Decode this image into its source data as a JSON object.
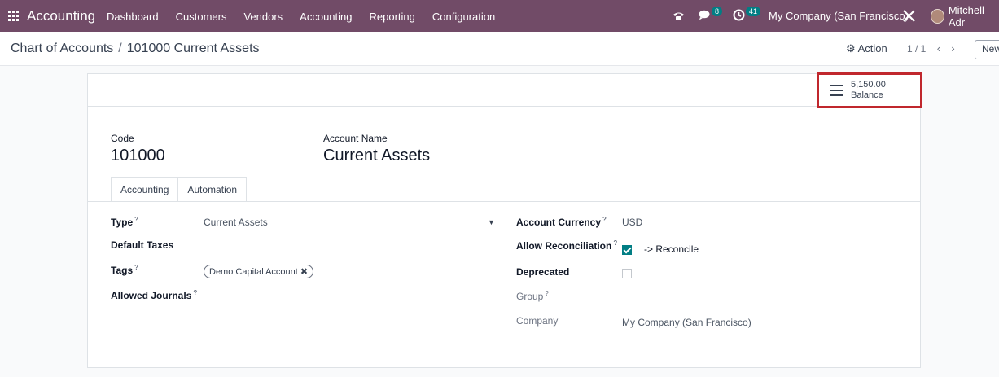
{
  "navbar": {
    "app_name": "Accounting",
    "menu": [
      "Dashboard",
      "Customers",
      "Vendors",
      "Accounting",
      "Reporting",
      "Configuration"
    ],
    "messages_count": "8",
    "activities_count": "41",
    "company": "My Company (San Francisco)",
    "user": "Mitchell Adr"
  },
  "control_panel": {
    "breadcrumb_parent": "Chart of Accounts",
    "breadcrumb_separator": "/",
    "breadcrumb_current": "101000 Current Assets",
    "action_label": "Action",
    "pager": "1 / 1",
    "new_label": "New"
  },
  "stat_button": {
    "value": "5,150.00",
    "label": "Balance"
  },
  "header_fields": {
    "code_label": "Code",
    "code_value": "101000",
    "name_label": "Account Name",
    "name_value": "Current Assets"
  },
  "tabs": [
    "Accounting",
    "Automation"
  ],
  "left_fields": {
    "type_label": "Type",
    "type_value": "Current Assets",
    "default_taxes_label": "Default Taxes",
    "tags_label": "Tags",
    "tag_value": "Demo Capital Account",
    "allowed_journals_label": "Allowed Journals"
  },
  "right_fields": {
    "currency_label": "Account Currency",
    "currency_value": "USD",
    "reconcile_label": "Allow Reconciliation",
    "reconcile_checked": true,
    "reconcile_link": "-> Reconcile",
    "deprecated_label": "Deprecated",
    "deprecated_checked": false,
    "group_label": "Group",
    "company_label": "Company",
    "company_value": "My Company (San Francisco)"
  },
  "colors": {
    "navbar": "#714b67",
    "accent": "#017e84",
    "highlight_border": "#c0272d"
  }
}
